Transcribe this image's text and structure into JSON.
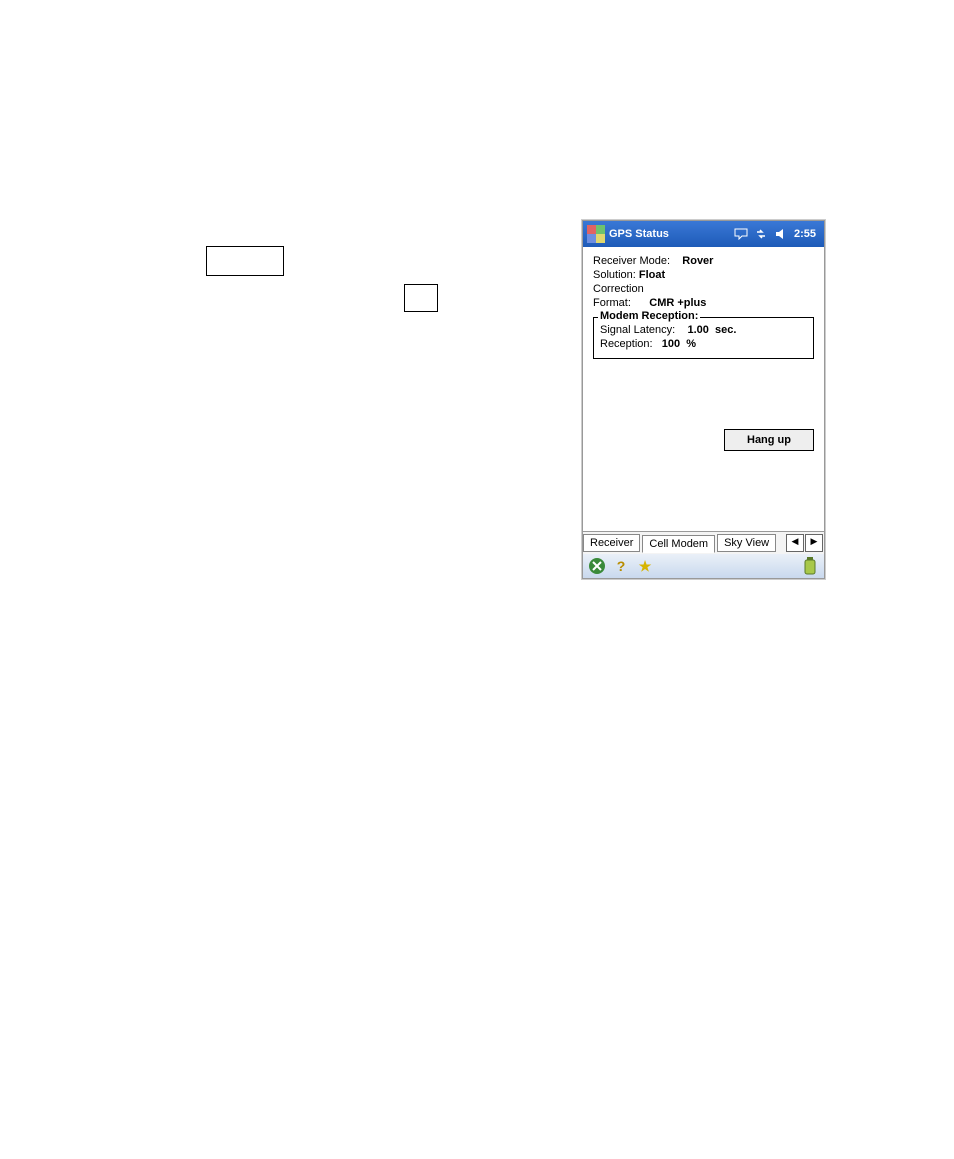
{
  "title": "GPS Status",
  "clock": "2:55",
  "fields": {
    "receiver_mode_label": "Receiver Mode:",
    "receiver_mode_value": "Rover",
    "solution_label": "Solution:",
    "solution_value": "Float",
    "correction_label": "Correction",
    "format_label": "Format:",
    "format_value": "CMR +plus"
  },
  "modem": {
    "legend": "Modem Reception:",
    "latency_label": "Signal Latency:",
    "latency_value": "1.00",
    "latency_unit": "sec.",
    "reception_label": "Reception:",
    "reception_value": "100",
    "reception_unit": "%"
  },
  "buttons": {
    "hangup": "Hang up"
  },
  "tabs": {
    "receiver": "Receiver",
    "cell_modem": "Cell Modem",
    "sky_view": "Sky View"
  },
  "icons": {
    "start": "windows-start-icon",
    "chat": "chat-bubble-icon",
    "sync": "sync-icon",
    "volume": "volume-icon",
    "close": "close-icon",
    "help": "help-icon",
    "favorite": "star-icon",
    "battery": "battery-icon",
    "nav_left": "◀",
    "nav_right": "▶"
  }
}
